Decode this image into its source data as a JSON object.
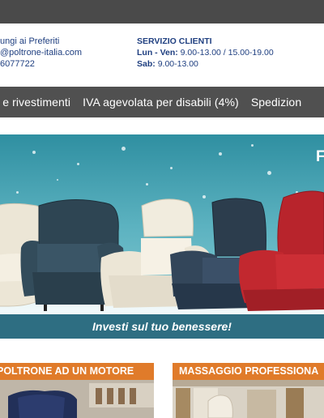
{
  "header": {
    "favorites": "ungi ai Preferiti",
    "email": "@poltrone-italia.com",
    "phone": "6077722",
    "service_title": "SERVIZIO CLIENTI",
    "hours_weekday_label": "Lun - Ven:",
    "hours_weekday": "9.00-13.00 / 15.00-19.00",
    "hours_sat_label": "Sab:",
    "hours_sat": "9.00-13.00"
  },
  "nav": {
    "items": [
      "i e rivestimenti",
      "IVA agevolata per disabili (4%)",
      "Spedizion"
    ]
  },
  "banner": {
    "tagline": "Investi sul tuo benessere!",
    "corner_letter": "F"
  },
  "cards": [
    {
      "title": "POLTRONE AD UN MOTORE"
    },
    {
      "title": "MASSAGGIO PROFESSIONA"
    }
  ],
  "colors": {
    "topbar": "#4a4a4a",
    "nav": "#505050",
    "accent_orange": "#e07b2a",
    "text_blue": "#1f3f80",
    "banner_teal": "#2e6e82"
  }
}
